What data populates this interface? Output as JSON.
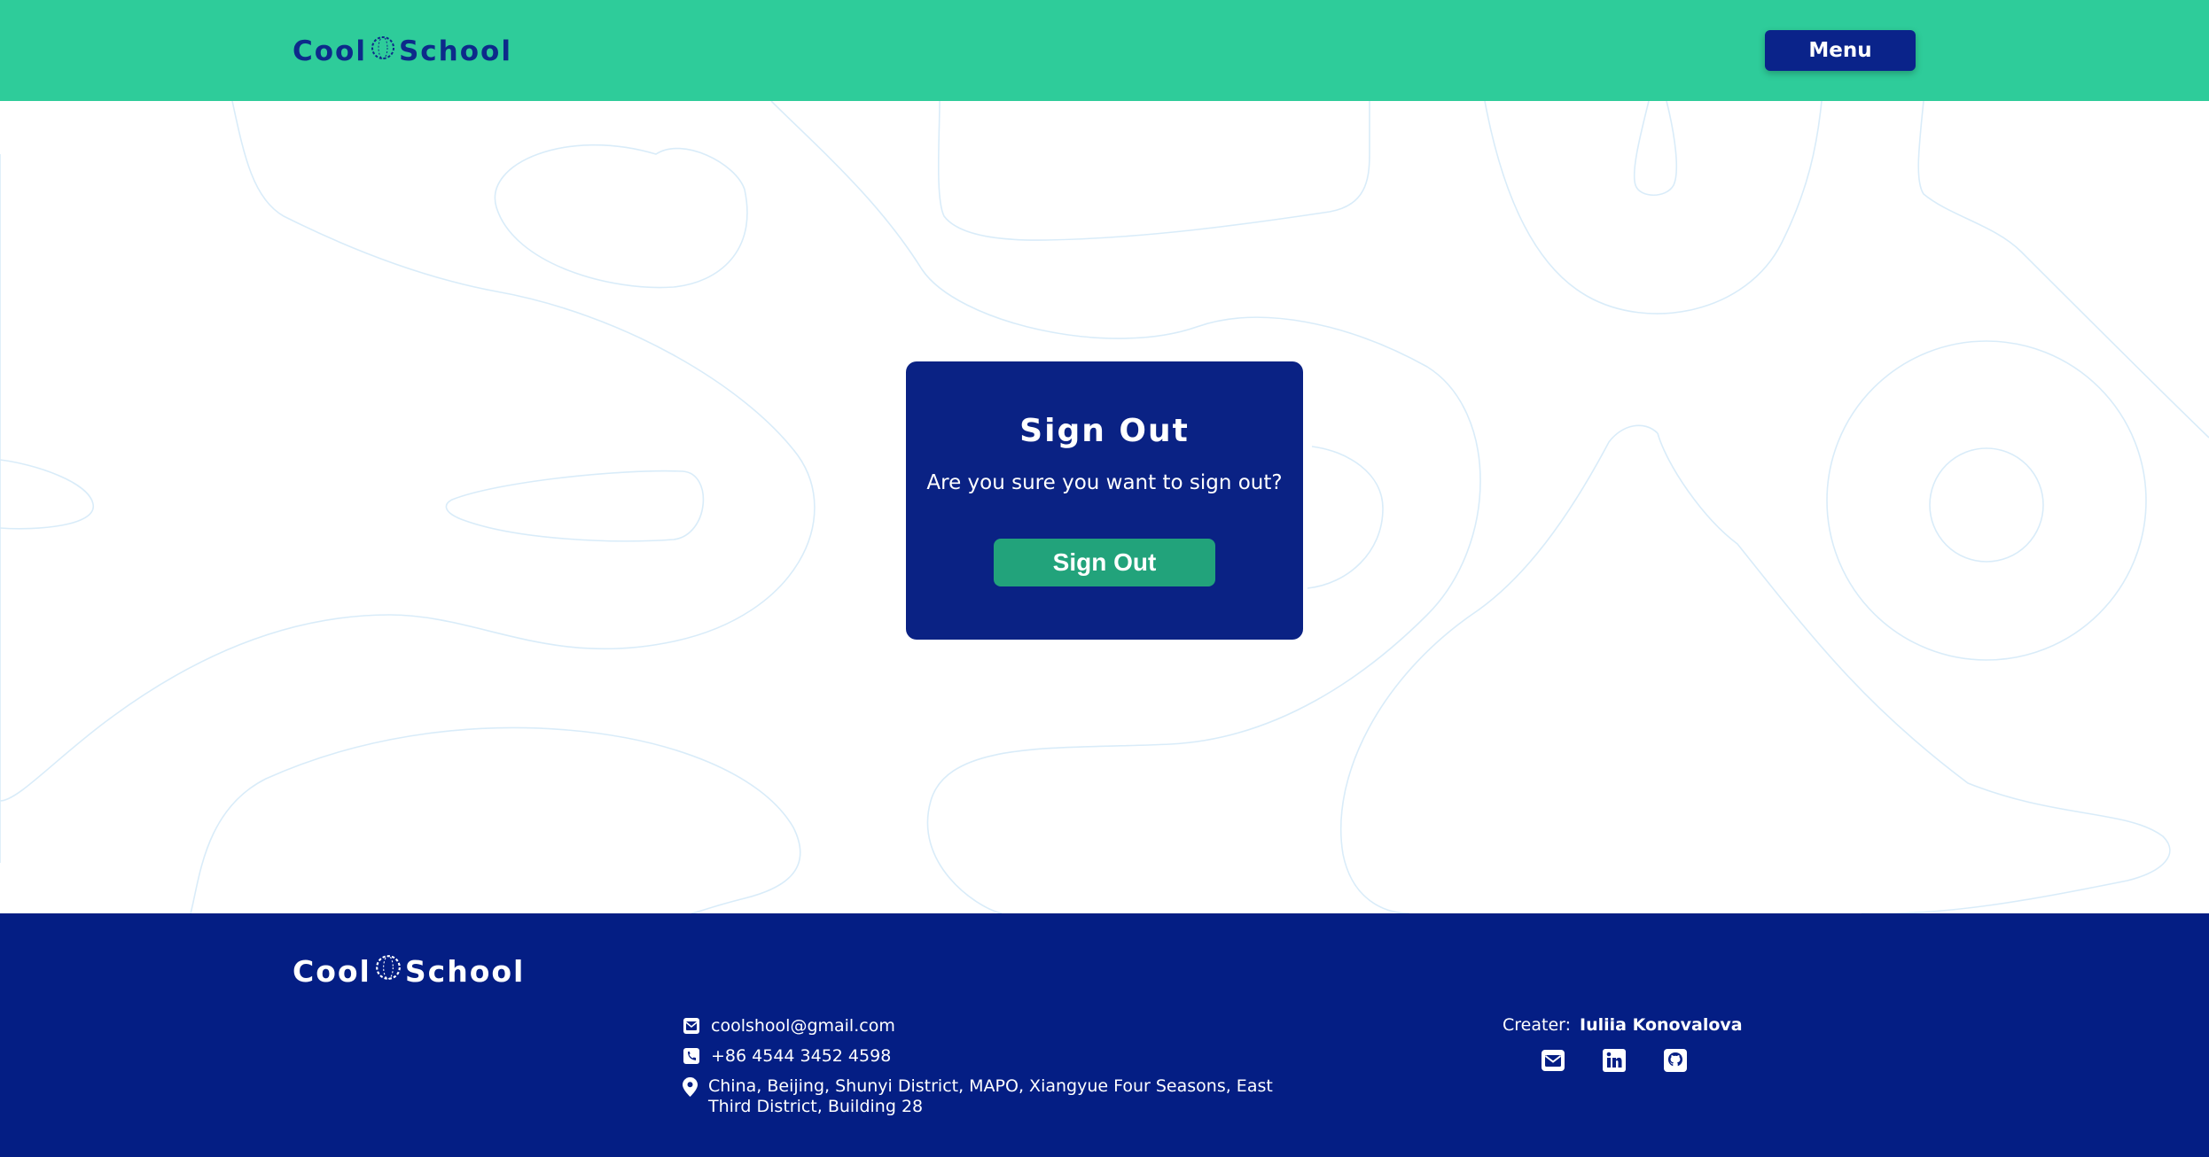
{
  "brand": {
    "name_part1": "Cool",
    "name_part2": "School"
  },
  "header": {
    "menu_label": "Menu",
    "background": "#2ecc9a"
  },
  "dialog": {
    "title": "Sign Out",
    "message": "Are you sure you want to sign out?",
    "button_label": "Sign Out",
    "background": "#0a2284",
    "button_color": "#22a37b"
  },
  "footer": {
    "email": "coolshool@gmail.com",
    "phone": "+86 4544 3452 4598",
    "address": "China, Beijing, Shunyi District, MAPO, Xiangyue Four Seasons, East Third District, Building 28",
    "creator_label": "Creater:",
    "creator_name": "Iuliia Konovalova",
    "social_icons": [
      "mail-icon",
      "linkedin-icon",
      "github-icon"
    ],
    "background": "#041e84"
  }
}
